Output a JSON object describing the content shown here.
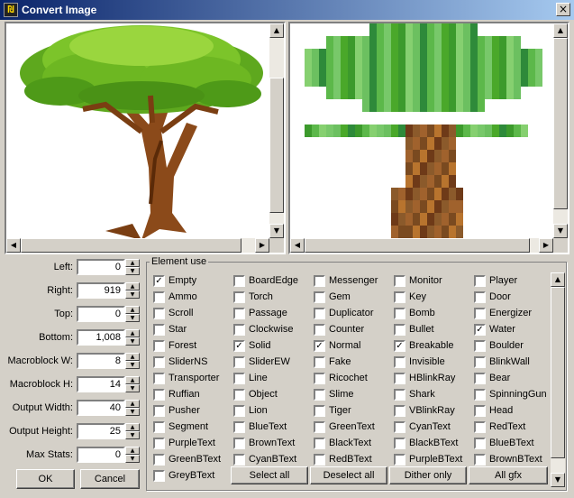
{
  "window": {
    "title": "Convert Image",
    "app_icon_glyph": "₪",
    "close_glyph": "×"
  },
  "fields": [
    {
      "label": "Left:",
      "value": "0"
    },
    {
      "label": "Right:",
      "value": "919"
    },
    {
      "label": "Top:",
      "value": "0"
    },
    {
      "label": "Bottom:",
      "value": "1,008"
    },
    {
      "label": "Macroblock W:",
      "value": "8"
    },
    {
      "label": "Macroblock H:",
      "value": "14"
    },
    {
      "label": "Output Width:",
      "value": "40"
    },
    {
      "label": "Output Height:",
      "value": "25"
    },
    {
      "label": "Max Stats:",
      "value": "0"
    }
  ],
  "buttons": {
    "ok": "OK",
    "cancel": "Cancel"
  },
  "element_use": {
    "legend": "Element use",
    "columns": [
      [
        {
          "label": "Empty",
          "checked": true
        },
        {
          "label": "Ammo",
          "checked": false
        },
        {
          "label": "Scroll",
          "checked": false
        },
        {
          "label": "Star",
          "checked": false
        },
        {
          "label": "Forest",
          "checked": false
        },
        {
          "label": "SliderNS",
          "checked": false
        },
        {
          "label": "Transporter",
          "checked": false
        },
        {
          "label": "Ruffian",
          "checked": false
        },
        {
          "label": "Pusher",
          "checked": false
        },
        {
          "label": "Segment",
          "checked": false
        },
        {
          "label": "PurpleText",
          "checked": false
        },
        {
          "label": "GreenBText",
          "checked": false
        },
        {
          "label": "GreyBText",
          "checked": false
        }
      ],
      [
        {
          "label": "BoardEdge",
          "checked": false
        },
        {
          "label": "Torch",
          "checked": false
        },
        {
          "label": "Passage",
          "checked": false
        },
        {
          "label": "Clockwise",
          "checked": false
        },
        {
          "label": "Solid",
          "checked": true
        },
        {
          "label": "SliderEW",
          "checked": false
        },
        {
          "label": "Line",
          "checked": false
        },
        {
          "label": "Object",
          "checked": false
        },
        {
          "label": "Lion",
          "checked": false
        },
        {
          "label": "BlueText",
          "checked": false
        },
        {
          "label": "BrownText",
          "checked": false
        },
        {
          "label": "CyanBText",
          "checked": false
        }
      ],
      [
        {
          "label": "Messenger",
          "checked": false
        },
        {
          "label": "Gem",
          "checked": false
        },
        {
          "label": "Duplicator",
          "checked": false
        },
        {
          "label": "Counter",
          "checked": false
        },
        {
          "label": "Normal",
          "checked": true
        },
        {
          "label": "Fake",
          "checked": false
        },
        {
          "label": "Ricochet",
          "checked": false
        },
        {
          "label": "Slime",
          "checked": false
        },
        {
          "label": "Tiger",
          "checked": false
        },
        {
          "label": "GreenText",
          "checked": false
        },
        {
          "label": "BlackText",
          "checked": false
        },
        {
          "label": "RedBText",
          "checked": false
        }
      ],
      [
        {
          "label": "Monitor",
          "checked": false
        },
        {
          "label": "Key",
          "checked": false
        },
        {
          "label": "Bomb",
          "checked": false
        },
        {
          "label": "Bullet",
          "checked": false
        },
        {
          "label": "Breakable",
          "checked": true
        },
        {
          "label": "Invisible",
          "checked": false
        },
        {
          "label": "HBlinkRay",
          "checked": false
        },
        {
          "label": "Shark",
          "checked": false
        },
        {
          "label": "VBlinkRay",
          "checked": false
        },
        {
          "label": "CyanText",
          "checked": false
        },
        {
          "label": "BlackBText",
          "checked": false
        },
        {
          "label": "PurpleBText",
          "checked": false
        }
      ],
      [
        {
          "label": "Player",
          "checked": false
        },
        {
          "label": "Door",
          "checked": false
        },
        {
          "label": "Energizer",
          "checked": false
        },
        {
          "label": "Water",
          "checked": true
        },
        {
          "label": "Boulder",
          "checked": false
        },
        {
          "label": "BlinkWall",
          "checked": false
        },
        {
          "label": "Bear",
          "checked": false
        },
        {
          "label": "SpinningGun",
          "checked": false
        },
        {
          "label": "Head",
          "checked": false
        },
        {
          "label": "RedText",
          "checked": false
        },
        {
          "label": "BlueBText",
          "checked": false
        },
        {
          "label": "BrownBText",
          "checked": false
        }
      ]
    ],
    "check_glyph": "✓",
    "actions": [
      "Select all",
      "Deselect all",
      "Dither only",
      "All gfx"
    ]
  },
  "scroll_glyphs": {
    "up": "▲",
    "down": "▼",
    "left": "◀",
    "right": "▶"
  }
}
